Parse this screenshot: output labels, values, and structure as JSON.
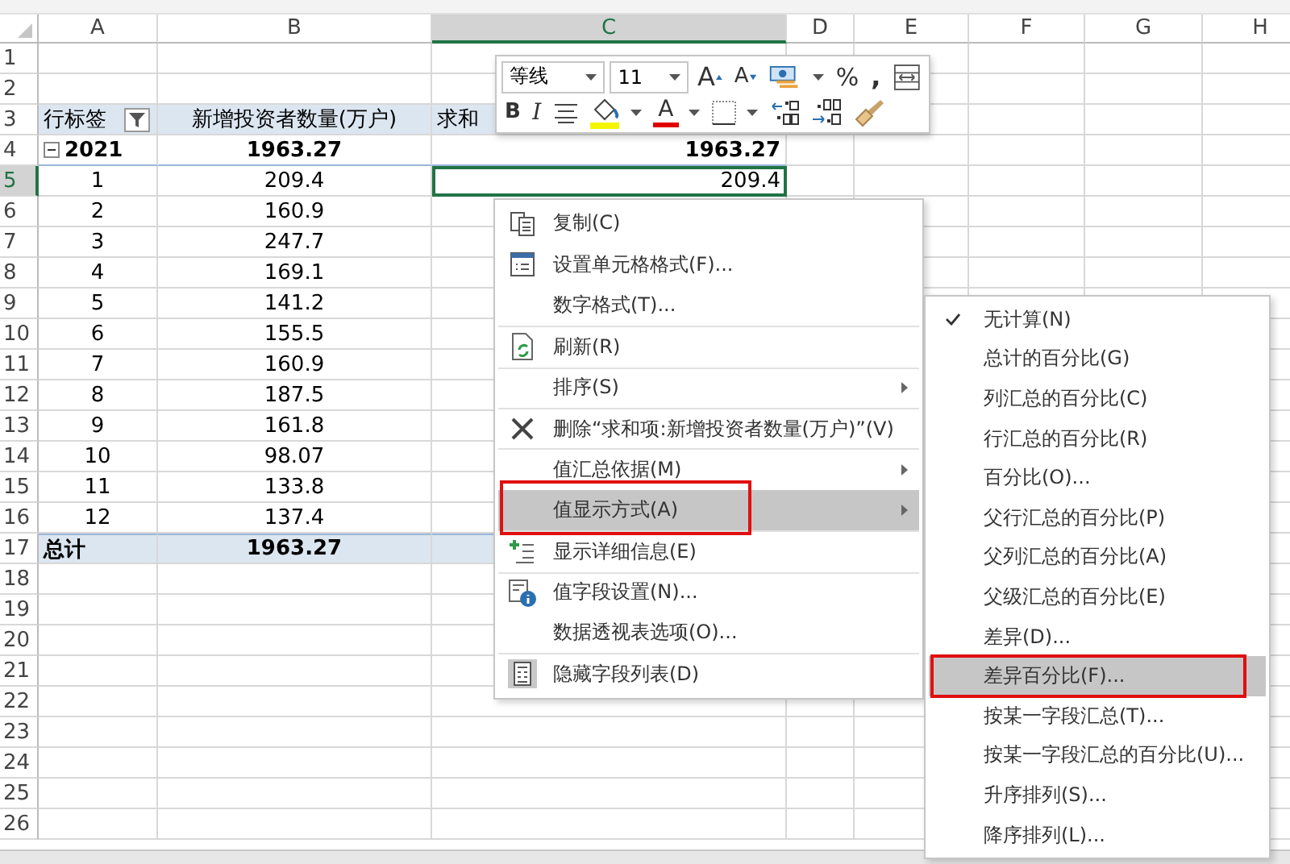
{
  "columns": [
    {
      "label": "A",
      "selected": false
    },
    {
      "label": "B",
      "selected": false
    },
    {
      "label": "C",
      "selected": true
    },
    {
      "label": "D",
      "selected": false
    },
    {
      "label": "E",
      "selected": false
    },
    {
      "label": "F",
      "selected": false
    },
    {
      "label": "G",
      "selected": false
    },
    {
      "label": "H",
      "selected": false
    }
  ],
  "rows": [
    {
      "num": "1",
      "kind": "blank",
      "selected": false
    },
    {
      "num": "2",
      "kind": "blank",
      "selected": false
    },
    {
      "num": "3",
      "kind": "header",
      "selected": false,
      "a": "行标签",
      "b": "新增投资者数量(万户)",
      "c": "求和"
    },
    {
      "num": "4",
      "kind": "subtotal",
      "selected": false,
      "a": "2021",
      "b": "1963.27",
      "c": "1963.27"
    },
    {
      "num": "5",
      "kind": "item",
      "selected": true,
      "a": "1",
      "b": "209.4",
      "c": "209.4"
    },
    {
      "num": "6",
      "kind": "item",
      "selected": false,
      "a": "2",
      "b": "160.9"
    },
    {
      "num": "7",
      "kind": "item",
      "selected": false,
      "a": "3",
      "b": "247.7"
    },
    {
      "num": "8",
      "kind": "item",
      "selected": false,
      "a": "4",
      "b": "169.1"
    },
    {
      "num": "9",
      "kind": "item",
      "selected": false,
      "a": "5",
      "b": "141.2"
    },
    {
      "num": "10",
      "kind": "item",
      "selected": false,
      "a": "6",
      "b": "155.5"
    },
    {
      "num": "11",
      "kind": "item",
      "selected": false,
      "a": "7",
      "b": "160.9"
    },
    {
      "num": "12",
      "kind": "item",
      "selected": false,
      "a": "8",
      "b": "187.5"
    },
    {
      "num": "13",
      "kind": "item",
      "selected": false,
      "a": "9",
      "b": "161.8"
    },
    {
      "num": "14",
      "kind": "item",
      "selected": false,
      "a": "10",
      "b": "98.07"
    },
    {
      "num": "15",
      "kind": "item",
      "selected": false,
      "a": "11",
      "b": "133.8"
    },
    {
      "num": "16",
      "kind": "item",
      "selected": false,
      "a": "12",
      "b": "137.4"
    },
    {
      "num": "17",
      "kind": "total",
      "selected": false,
      "a": "总计",
      "b": "1963.27"
    },
    {
      "num": "18",
      "kind": "blank",
      "selected": false
    },
    {
      "num": "19",
      "kind": "blank",
      "selected": false
    },
    {
      "num": "20",
      "kind": "blank",
      "selected": false
    },
    {
      "num": "21",
      "kind": "blank",
      "selected": false
    },
    {
      "num": "22",
      "kind": "blank",
      "selected": false
    },
    {
      "num": "23",
      "kind": "blank",
      "selected": false
    },
    {
      "num": "24",
      "kind": "blank",
      "selected": false
    },
    {
      "num": "25",
      "kind": "blank",
      "selected": false
    },
    {
      "num": "26",
      "kind": "blank",
      "selected": false
    }
  ],
  "mini_toolbar": {
    "font": "等线",
    "size": "11",
    "rows": [
      [
        {
          "kind": "grow-font",
          "label": "A"
        },
        {
          "kind": "shrink-font",
          "label": "A"
        },
        {
          "kind": "accounting"
        },
        {
          "kind": "caret"
        },
        {
          "kind": "percent",
          "label": "%"
        },
        {
          "kind": "comma",
          "label": ","
        },
        {
          "kind": "wrap"
        }
      ],
      [
        {
          "kind": "bold",
          "label": "B"
        },
        {
          "kind": "italic",
          "label": "I"
        },
        {
          "kind": "align"
        },
        {
          "kind": "fill-color"
        },
        {
          "kind": "caret"
        },
        {
          "kind": "font-color",
          "label": "A"
        },
        {
          "kind": "caret"
        },
        {
          "kind": "borders"
        },
        {
          "kind": "caret"
        },
        {
          "kind": "increase-decimal"
        },
        {
          "kind": "decrease-decimal"
        },
        {
          "kind": "painter"
        }
      ]
    ]
  },
  "context_menu": {
    "items": [
      {
        "label": "复制(C)",
        "kind": "copy",
        "submenu": false,
        "highlighted": false,
        "annotated": false,
        "separator": false
      },
      {
        "label": "设置单元格格式(F)...",
        "kind": "format",
        "submenu": false,
        "highlighted": false,
        "annotated": false,
        "separator": false
      },
      {
        "label": "数字格式(T)...",
        "kind": "plain",
        "submenu": false,
        "highlighted": false,
        "annotated": false,
        "separator": false
      },
      {
        "label": "刷新(R)",
        "kind": "refresh",
        "submenu": false,
        "highlighted": false,
        "annotated": false,
        "separator": true
      },
      {
        "label": "排序(S)",
        "kind": "plain",
        "submenu": true,
        "highlighted": false,
        "annotated": false,
        "separator": true
      },
      {
        "label": "删除“求和项:新增投资者数量(万户)”(V)",
        "kind": "delete",
        "submenu": false,
        "highlighted": false,
        "annotated": false,
        "separator": true
      },
      {
        "label": "值汇总依据(M)",
        "kind": "plain",
        "submenu": true,
        "highlighted": false,
        "annotated": false,
        "separator": true
      },
      {
        "label": "值显示方式(A)",
        "kind": "plain",
        "submenu": true,
        "highlighted": true,
        "annotated": true,
        "separator": false
      },
      {
        "label": "显示详细信息(E)",
        "kind": "details",
        "submenu": false,
        "highlighted": false,
        "annotated": false,
        "separator": true
      },
      {
        "label": "值字段设置(N)...",
        "kind": "field-settings",
        "submenu": false,
        "highlighted": false,
        "annotated": false,
        "separator": true
      },
      {
        "label": "数据透视表选项(O)...",
        "kind": "plain",
        "submenu": false,
        "highlighted": false,
        "annotated": false,
        "separator": false
      },
      {
        "label": "隐藏字段列表(D)",
        "kind": "field-list",
        "submenu": false,
        "highlighted": false,
        "annotated": false,
        "separator": true
      }
    ]
  },
  "submenu": {
    "items": [
      {
        "label": "无计算(N)",
        "checked": true,
        "highlighted": false,
        "annotated": false
      },
      {
        "label": "总计的百分比(G)",
        "checked": false,
        "highlighted": false,
        "annotated": false
      },
      {
        "label": "列汇总的百分比(C)",
        "checked": false,
        "highlighted": false,
        "annotated": false
      },
      {
        "label": "行汇总的百分比(R)",
        "checked": false,
        "highlighted": false,
        "annotated": false
      },
      {
        "label": "百分比(O)...",
        "checked": false,
        "highlighted": false,
        "annotated": false
      },
      {
        "label": "父行汇总的百分比(P)",
        "checked": false,
        "highlighted": false,
        "annotated": false
      },
      {
        "label": "父列汇总的百分比(A)",
        "checked": false,
        "highlighted": false,
        "annotated": false
      },
      {
        "label": "父级汇总的百分比(E)",
        "checked": false,
        "highlighted": false,
        "annotated": false
      },
      {
        "label": "差异(D)...",
        "checked": false,
        "highlighted": false,
        "annotated": false
      },
      {
        "label": "差异百分比(F)...",
        "checked": false,
        "highlighted": true,
        "annotated": true
      },
      {
        "label": "按某一字段汇总(T)...",
        "checked": false,
        "highlighted": false,
        "annotated": false
      },
      {
        "label": "按某一字段汇总的百分比(U)...",
        "checked": false,
        "highlighted": false,
        "annotated": false
      },
      {
        "label": "升序排列(S)...",
        "checked": false,
        "highlighted": false,
        "annotated": false
      },
      {
        "label": "降序排列(L)...",
        "checked": false,
        "highlighted": false,
        "annotated": false
      }
    ]
  }
}
